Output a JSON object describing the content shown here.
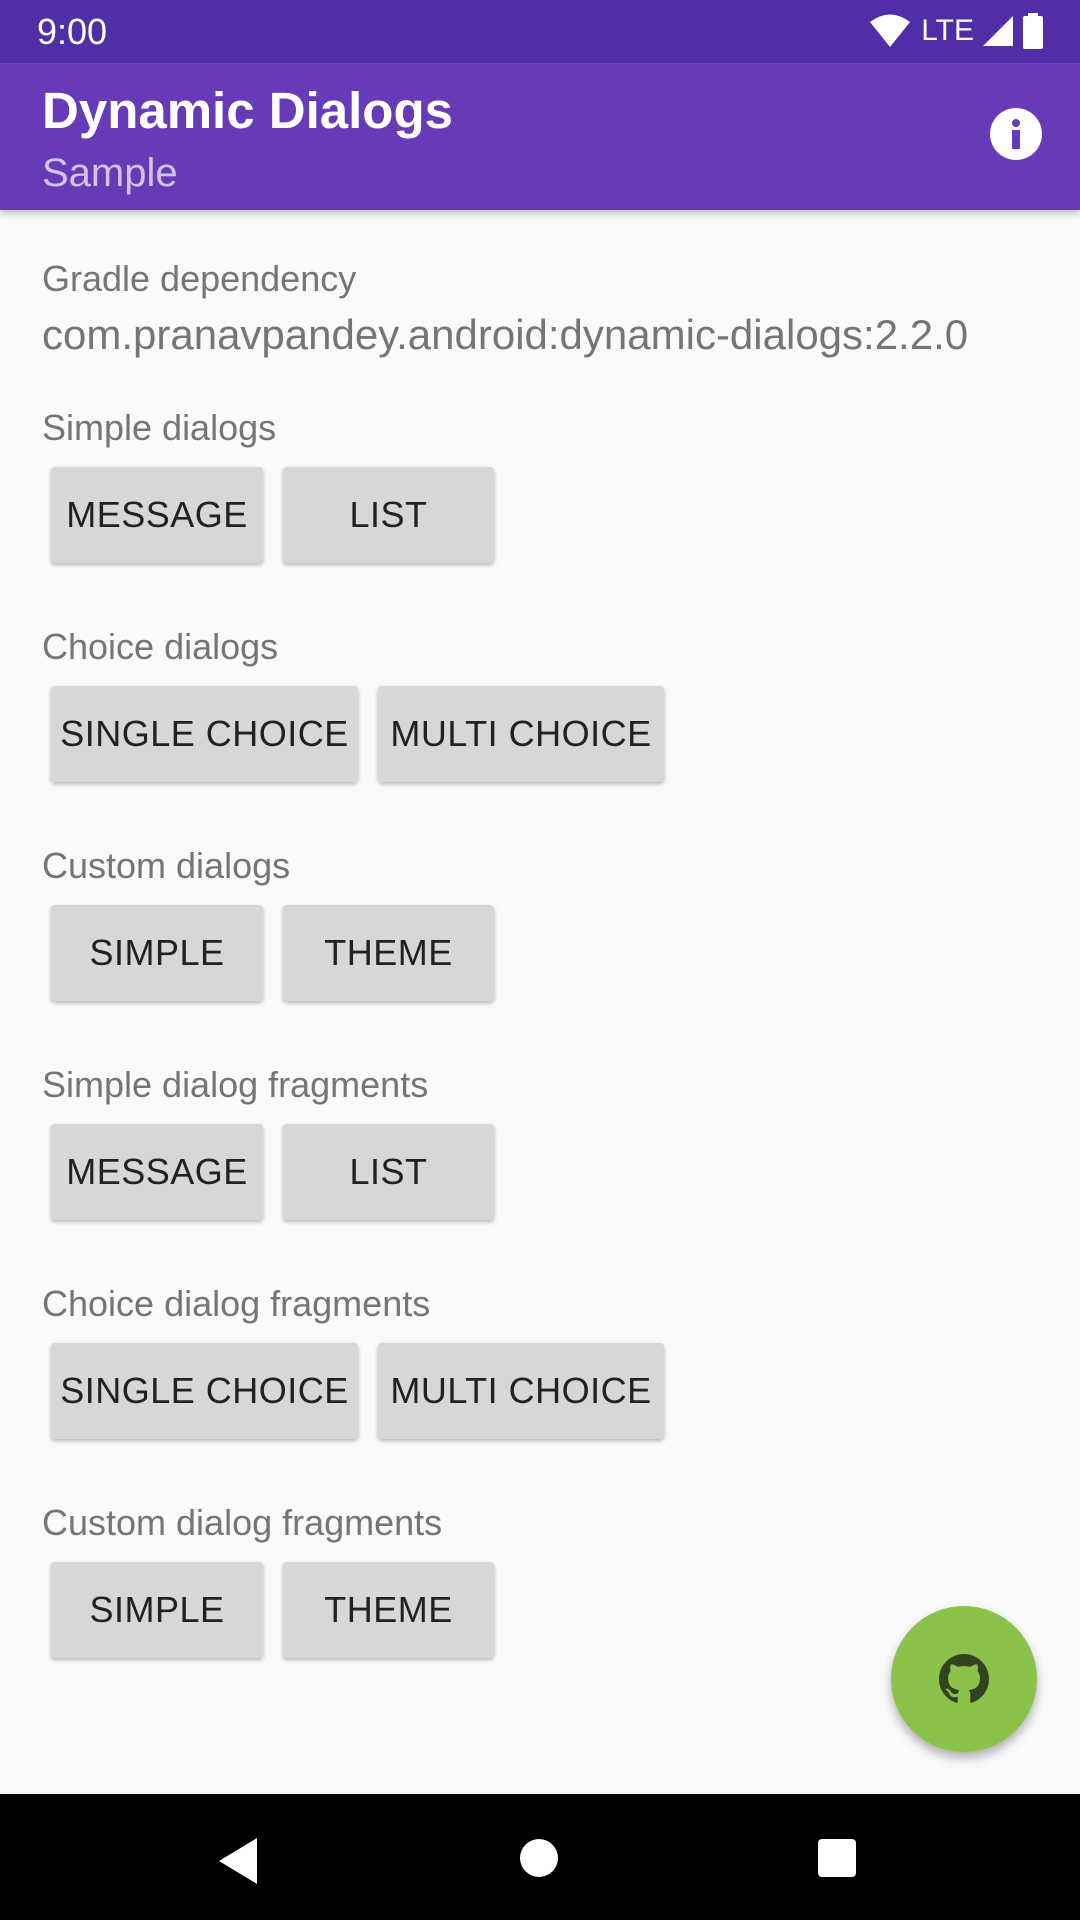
{
  "status_bar": {
    "time": "9:00",
    "network": "LTE",
    "icons": [
      "wifi-icon",
      "cell-signal-icon",
      "battery-icon"
    ]
  },
  "app_bar": {
    "title": "Dynamic Dialogs",
    "subtitle": "Sample",
    "action_icon": "info-icon"
  },
  "dependency": {
    "label": "Gradle dependency",
    "value": "com.pranavpandey.android:dynamic-dialogs:2.2.0"
  },
  "sections": [
    {
      "label": "Simple dialogs",
      "buttons": [
        "MESSAGE",
        "LIST"
      ]
    },
    {
      "label": "Choice dialogs",
      "buttons": [
        "SINGLE CHOICE",
        "MULTI CHOICE"
      ]
    },
    {
      "label": "Custom dialogs",
      "buttons": [
        "SIMPLE",
        "THEME"
      ]
    },
    {
      "label": "Simple dialog fragments",
      "buttons": [
        "MESSAGE",
        "LIST"
      ]
    },
    {
      "label": "Choice dialog fragments",
      "buttons": [
        "SINGLE CHOICE",
        "MULTI CHOICE"
      ]
    },
    {
      "label": "Custom dialog fragments",
      "buttons": [
        "SIMPLE",
        "THEME"
      ]
    }
  ],
  "fab": {
    "icon": "github-icon"
  },
  "nav_bar": {
    "icons": [
      "back-icon",
      "home-icon",
      "recents-icon"
    ]
  },
  "colors": {
    "status_bar": "#512da8",
    "primary": "#673ab7",
    "accent_fab": "#8bc34a",
    "button": "#d6d7d7",
    "background": "#fafafa"
  }
}
